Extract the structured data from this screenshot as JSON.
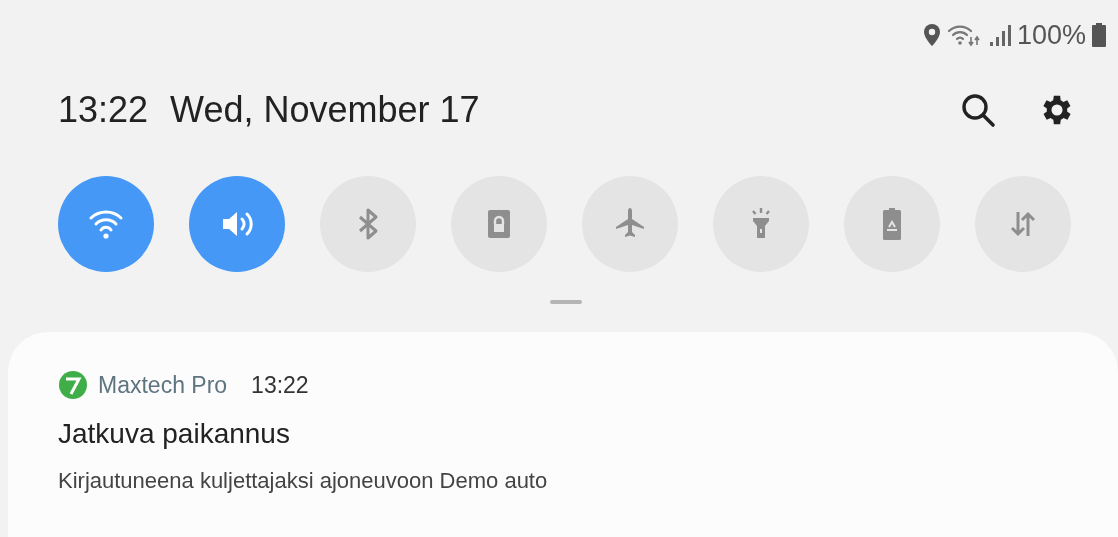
{
  "status_bar": {
    "battery": "100%"
  },
  "header": {
    "time": "13:22",
    "date": "Wed, November 17"
  },
  "quick_tiles": [
    {
      "kind": "wifi",
      "on": true
    },
    {
      "kind": "sound",
      "on": true
    },
    {
      "kind": "bluetooth",
      "on": false
    },
    {
      "kind": "lock",
      "on": false
    },
    {
      "kind": "airplane",
      "on": false
    },
    {
      "kind": "flashlight",
      "on": false
    },
    {
      "kind": "power",
      "on": false
    },
    {
      "kind": "data",
      "on": false
    }
  ],
  "notification": {
    "app": "Maxtech Pro",
    "time": "13:22",
    "title": "Jatkuva paikannus",
    "text": "Kirjautuneena kuljettajaksi ajoneuvoon Demo auto"
  }
}
